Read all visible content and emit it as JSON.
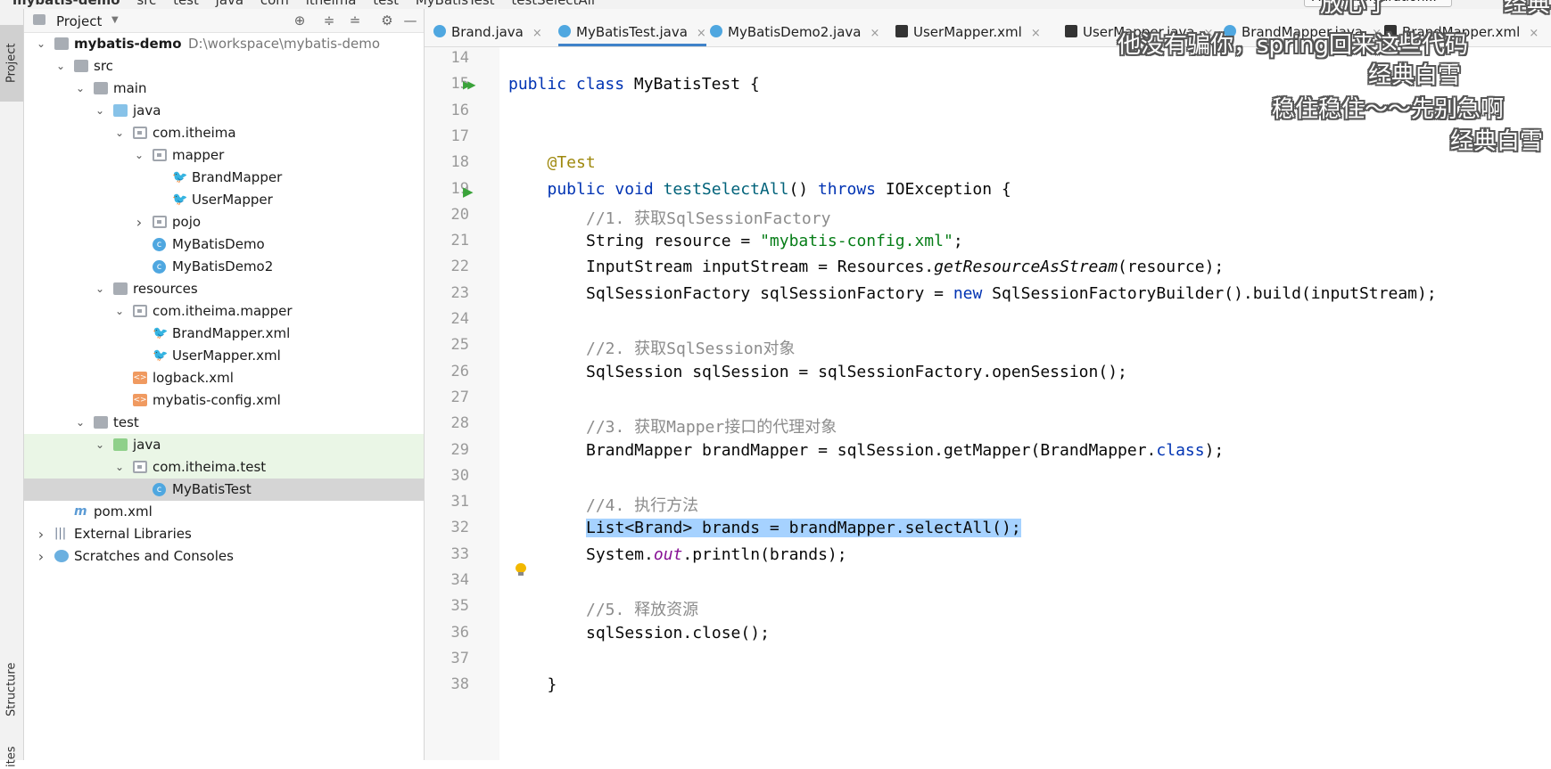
{
  "breadcrumbs": [
    "mybatis-demo",
    "src",
    "test",
    "java",
    "com",
    "itheima",
    "test",
    "MyBatisTest",
    "testSelectAll"
  ],
  "run_config": "Add Configuration...",
  "left_tabs": {
    "project": "Project",
    "structure": "Structure",
    "favorites": "ites"
  },
  "project_panel": {
    "title": "Project"
  },
  "tree": [
    {
      "label": "mybatis-demo",
      "path": "D:\\workspace\\mybatis-demo",
      "depth": 0,
      "icon": "folder",
      "arrow": "down",
      "bold": true
    },
    {
      "label": "src",
      "depth": 1,
      "icon": "folder",
      "arrow": "down"
    },
    {
      "label": "main",
      "depth": 2,
      "icon": "folder",
      "arrow": "down"
    },
    {
      "label": "java",
      "depth": 3,
      "icon": "folder-blue",
      "arrow": "down"
    },
    {
      "label": "com.itheima",
      "depth": 4,
      "icon": "package",
      "arrow": "down"
    },
    {
      "label": "mapper",
      "depth": 5,
      "icon": "package",
      "arrow": "down"
    },
    {
      "label": "BrandMapper",
      "depth": 6,
      "icon": "mybatis-bird-icon",
      "arrow": ""
    },
    {
      "label": "UserMapper",
      "depth": 6,
      "icon": "mybatis-bird-icon",
      "arrow": ""
    },
    {
      "label": "pojo",
      "depth": 5,
      "icon": "package",
      "arrow": "right"
    },
    {
      "label": "MyBatisDemo",
      "depth": 5,
      "icon": "class",
      "arrow": ""
    },
    {
      "label": "MyBatisDemo2",
      "depth": 5,
      "icon": "class",
      "arrow": ""
    },
    {
      "label": "resources",
      "depth": 3,
      "icon": "folder",
      "arrow": "down"
    },
    {
      "label": "com.itheima.mapper",
      "depth": 4,
      "icon": "package",
      "arrow": "down"
    },
    {
      "label": "BrandMapper.xml",
      "depth": 5,
      "icon": "mybatis-bird-icon",
      "arrow": ""
    },
    {
      "label": "UserMapper.xml",
      "depth": 5,
      "icon": "mybatis-bird-icon",
      "arrow": ""
    },
    {
      "label": "logback.xml",
      "depth": 4,
      "icon": "xml",
      "arrow": ""
    },
    {
      "label": "mybatis-config.xml",
      "depth": 4,
      "icon": "xml",
      "arrow": ""
    },
    {
      "label": "test",
      "depth": 2,
      "icon": "folder",
      "arrow": "down"
    },
    {
      "label": "java",
      "depth": 3,
      "icon": "folder-green",
      "arrow": "down",
      "highlight": true
    },
    {
      "label": "com.itheima.test",
      "depth": 4,
      "icon": "package",
      "arrow": "down",
      "highlight": true
    },
    {
      "label": "MyBatisTest",
      "depth": 5,
      "icon": "class",
      "arrow": "",
      "selected": true
    },
    {
      "label": "pom.xml",
      "depth": 1,
      "icon": "maven",
      "arrow": ""
    },
    {
      "label": "External Libraries",
      "depth": 0,
      "icon": "library",
      "arrow": "right"
    },
    {
      "label": "Scratches and Consoles",
      "depth": 0,
      "icon": "scratch",
      "arrow": "right"
    }
  ],
  "tabs": [
    {
      "label": "Brand.java",
      "icon": "class",
      "active": false
    },
    {
      "label": "MyBatisTest.java",
      "icon": "class",
      "active": true
    },
    {
      "label": "MyBatisDemo2.java",
      "icon": "class",
      "active": false
    },
    {
      "label": "UserMapper.xml",
      "icon": "xml",
      "active": false
    },
    {
      "label": "UserMapper.java",
      "icon": "xml",
      "active": false
    },
    {
      "label": "BrandMapper.java",
      "icon": "class",
      "active": false
    },
    {
      "label": "BrandMapper.xml",
      "icon": "xml",
      "active": false
    }
  ],
  "code_lines": [
    {
      "n": "14",
      "html": ""
    },
    {
      "n": "15",
      "html": "<span class=\"kw\">public class</span> MyBatisTest {",
      "indent": 0,
      "run": "double"
    },
    {
      "n": "16",
      "html": ""
    },
    {
      "n": "17",
      "html": ""
    },
    {
      "n": "18",
      "html": "<span class=\"an\">@Test</span>",
      "indent": 1
    },
    {
      "n": "19",
      "html": "<span class=\"kw\">public void</span> <span class=\"fn\">testSelectAll</span>() <span class=\"kw\">throws</span> IOException {",
      "indent": 1,
      "run": "single"
    },
    {
      "n": "20",
      "html": "<span class=\"cm\">//1. 获取SqlSessionFactory</span>",
      "indent": 2
    },
    {
      "n": "21",
      "html": "String resource = <span class=\"str\">\"mybatis-config.xml\"</span>;",
      "indent": 2
    },
    {
      "n": "22",
      "html": "InputStream inputStream = Resources.<span class=\"it\">getResourceAsStream</span>(resource);",
      "indent": 2
    },
    {
      "n": "23",
      "html": "SqlSessionFactory sqlSessionFactory = <span class=\"kw\">new</span> SqlSessionFactoryBuilder().build(inputStream);",
      "indent": 2
    },
    {
      "n": "24",
      "html": ""
    },
    {
      "n": "25",
      "html": "<span class=\"cm\">//2. 获取SqlSession对象</span>",
      "indent": 2
    },
    {
      "n": "26",
      "html": "SqlSession sqlSession = sqlSessionFactory.openSession();",
      "indent": 2
    },
    {
      "n": "27",
      "html": ""
    },
    {
      "n": "28",
      "html": "<span class=\"cm\">//3. 获取Mapper接口的代理对象</span>",
      "indent": 2
    },
    {
      "n": "29",
      "html": "BrandMapper brandMapper = sqlSession.getMapper(BrandMapper.<span class=\"kw\">class</span>);",
      "indent": 2
    },
    {
      "n": "30",
      "html": ""
    },
    {
      "n": "31",
      "html": "<span class=\"cm\">//4. 执行方法</span>",
      "indent": 2
    },
    {
      "n": "32",
      "html": "<span class=\"selcode\">List&lt;Brand&gt; brands = brandMapper.selectAll();</span>",
      "indent": 2
    },
    {
      "n": "33",
      "html": "System.<span class=\"fld\">out</span>.println(brands);",
      "indent": 2
    },
    {
      "n": "34",
      "html": ""
    },
    {
      "n": "35",
      "html": "<span class=\"cm\">//5. 释放资源</span>",
      "indent": 2
    },
    {
      "n": "36",
      "html": "sqlSession.close();",
      "indent": 2
    },
    {
      "n": "37",
      "html": ""
    },
    {
      "n": "38",
      "html": "}",
      "indent": 1
    }
  ],
  "overlay_subtitles": [
    "他没有骗你，spring回来这些代码",
    "经典白雪",
    "稳住稳住～～先别急啊",
    "经典白雪"
  ],
  "top_right_overlay": [
    "放心了",
    "经典"
  ]
}
